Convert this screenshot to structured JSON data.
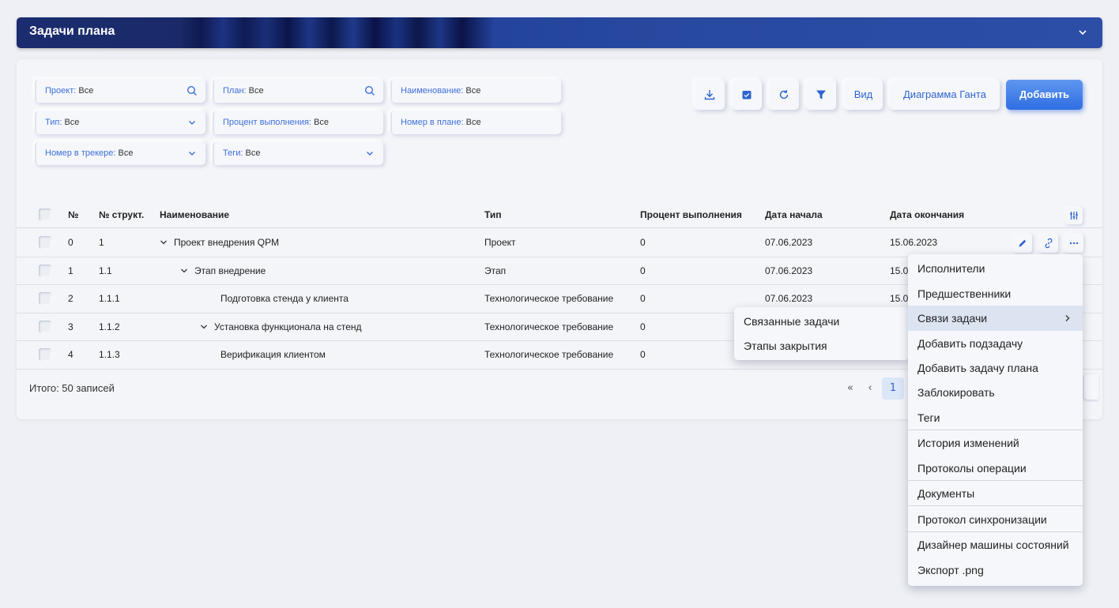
{
  "header": {
    "title": "Задачи плана"
  },
  "filters": [
    {
      "label": "Проект:",
      "value": "Все",
      "icon": "search-icon"
    },
    {
      "label": "План:",
      "value": "Все",
      "icon": "search-icon"
    },
    {
      "label": "Наименование:",
      "value": "Все"
    },
    {
      "label": "Тип:",
      "value": "Все",
      "icon": "chevron-down-icon"
    },
    {
      "label": "Процент выполнения:",
      "value": "Все"
    },
    {
      "label": "Номер в плане:",
      "value": "Все"
    },
    {
      "label": "Номер в трекере:",
      "value": "Все",
      "icon": "chevron-down-icon"
    },
    {
      "label": "Теги:",
      "value": "Все",
      "icon": "chevron-down-icon"
    }
  ],
  "toolbar": {
    "icons": [
      "download-icon",
      "calendar-check-icon",
      "refresh-icon",
      "filter-icon"
    ],
    "view_label": "Вид",
    "gantt_label": "Диаграмма Ганта",
    "add_label": "Добавить",
    "accent": "#2f6ee3"
  },
  "table": {
    "columns": [
      "№",
      "№ структ.",
      "Наименование",
      "Тип",
      "Процент выполнения",
      "Дата начала",
      "Дата окончания"
    ],
    "rows": [
      {
        "num": "0",
        "struct": "1",
        "name": "Проект внедрения QPM",
        "type": "Проект",
        "percent": "0",
        "start": "07.06.2023",
        "end": "15.06.2023"
      },
      {
        "num": "1",
        "struct": "1.1",
        "name": "Этап внедрение",
        "type": "Этап",
        "percent": "0",
        "start": "07.06.2023",
        "end": "15.0"
      },
      {
        "num": "2",
        "struct": "1.1.1",
        "name": "Подготовка стенда у клиента",
        "type": "Технологическое требование",
        "percent": "0",
        "start": "07.06.2023",
        "end": "15.0"
      },
      {
        "num": "3",
        "struct": "1.1.2",
        "name": "Установка функционала на стенд",
        "type": "Технологическое требование",
        "percent": "0",
        "start": "",
        "end": ""
      },
      {
        "num": "4",
        "struct": "1.1.3",
        "name": "Верификация клиентом",
        "type": "Технологическое требование",
        "percent": "0",
        "start": "",
        "end": ""
      }
    ]
  },
  "footer": {
    "total": "Итого: 50 записей",
    "page": "1",
    "first": "«",
    "prev": "‹"
  },
  "context_menu": {
    "items": [
      "Исполнители",
      "Предшественники",
      "Связи задачи",
      "Добавить подзадачу",
      "Добавить задачу плана",
      "Заблокировать",
      "Теги",
      "История изменений",
      "Протоколы операции",
      "Документы",
      "Протокол синхронизации",
      "Дизайнер машины состояний",
      "Экспорт .png"
    ],
    "highlighted": "Связи задачи"
  },
  "submenu": {
    "items": [
      "Связанные задачи",
      "Этапы закрытия"
    ]
  }
}
